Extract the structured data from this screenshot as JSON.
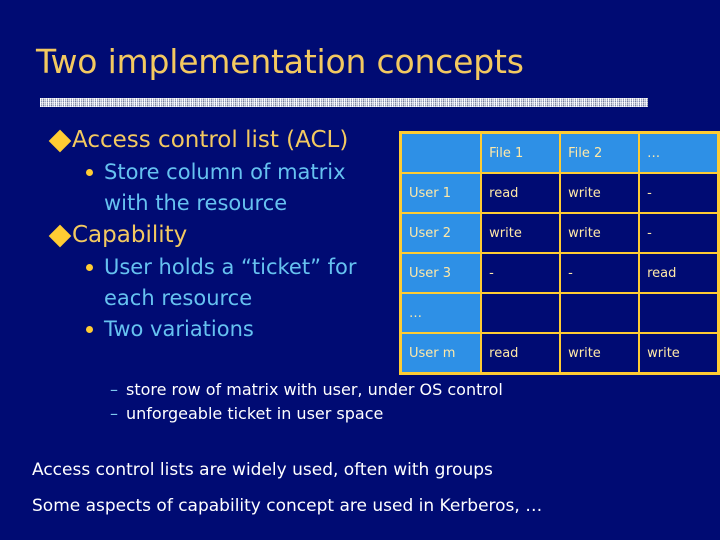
{
  "slide": {
    "title": "Two implementation concepts",
    "background_color": "#000b73",
    "title_color": "#f3c960",
    "accent_color": "#ffcc33",
    "level2_color": "#66c2f0"
  },
  "bullets": [
    {
      "level": 1,
      "marker": "diamond-bullet-icon",
      "text": "Access control list (ACL)"
    },
    {
      "level": 2,
      "marker": "dot-bullet-icon",
      "text": "Store column of matrix with the resource"
    },
    {
      "level": 1,
      "marker": "diamond-bullet-icon",
      "text": "Capability"
    },
    {
      "level": 2,
      "marker": "dot-bullet-icon",
      "text": "User holds a “ticket” for each resource"
    },
    {
      "level": 2,
      "marker": "dot-bullet-icon",
      "text": "Two variations"
    }
  ],
  "sub_bullets": {
    "dash": "–",
    "items": [
      "store row of matrix with user, under OS control",
      "unforgeable ticket in user space"
    ]
  },
  "footer": {
    "lines": [
      "Access control lists are widely used, often with groups",
      "Some aspects of capability concept are used in Kerberos, …"
    ]
  },
  "matrix": {
    "header": [
      "",
      "File 1",
      "File 2",
      "…"
    ],
    "rows": [
      {
        "label": "User 1",
        "cells": [
          "read",
          "write",
          "-"
        ]
      },
      {
        "label": "User 2",
        "cells": [
          "write",
          "write",
          "-"
        ]
      },
      {
        "label": "User 3",
        "cells": [
          "-",
          "-",
          "read"
        ]
      },
      {
        "label": "…",
        "cells": [
          "",
          "",
          ""
        ]
      },
      {
        "label": "User m",
        "cells": [
          "read",
          "write",
          "write"
        ]
      }
    ],
    "header_bg": "#2e90e6",
    "data_bg": "#000b73",
    "border_color": "#ffcc33",
    "text_color": "#ffe9a8"
  }
}
